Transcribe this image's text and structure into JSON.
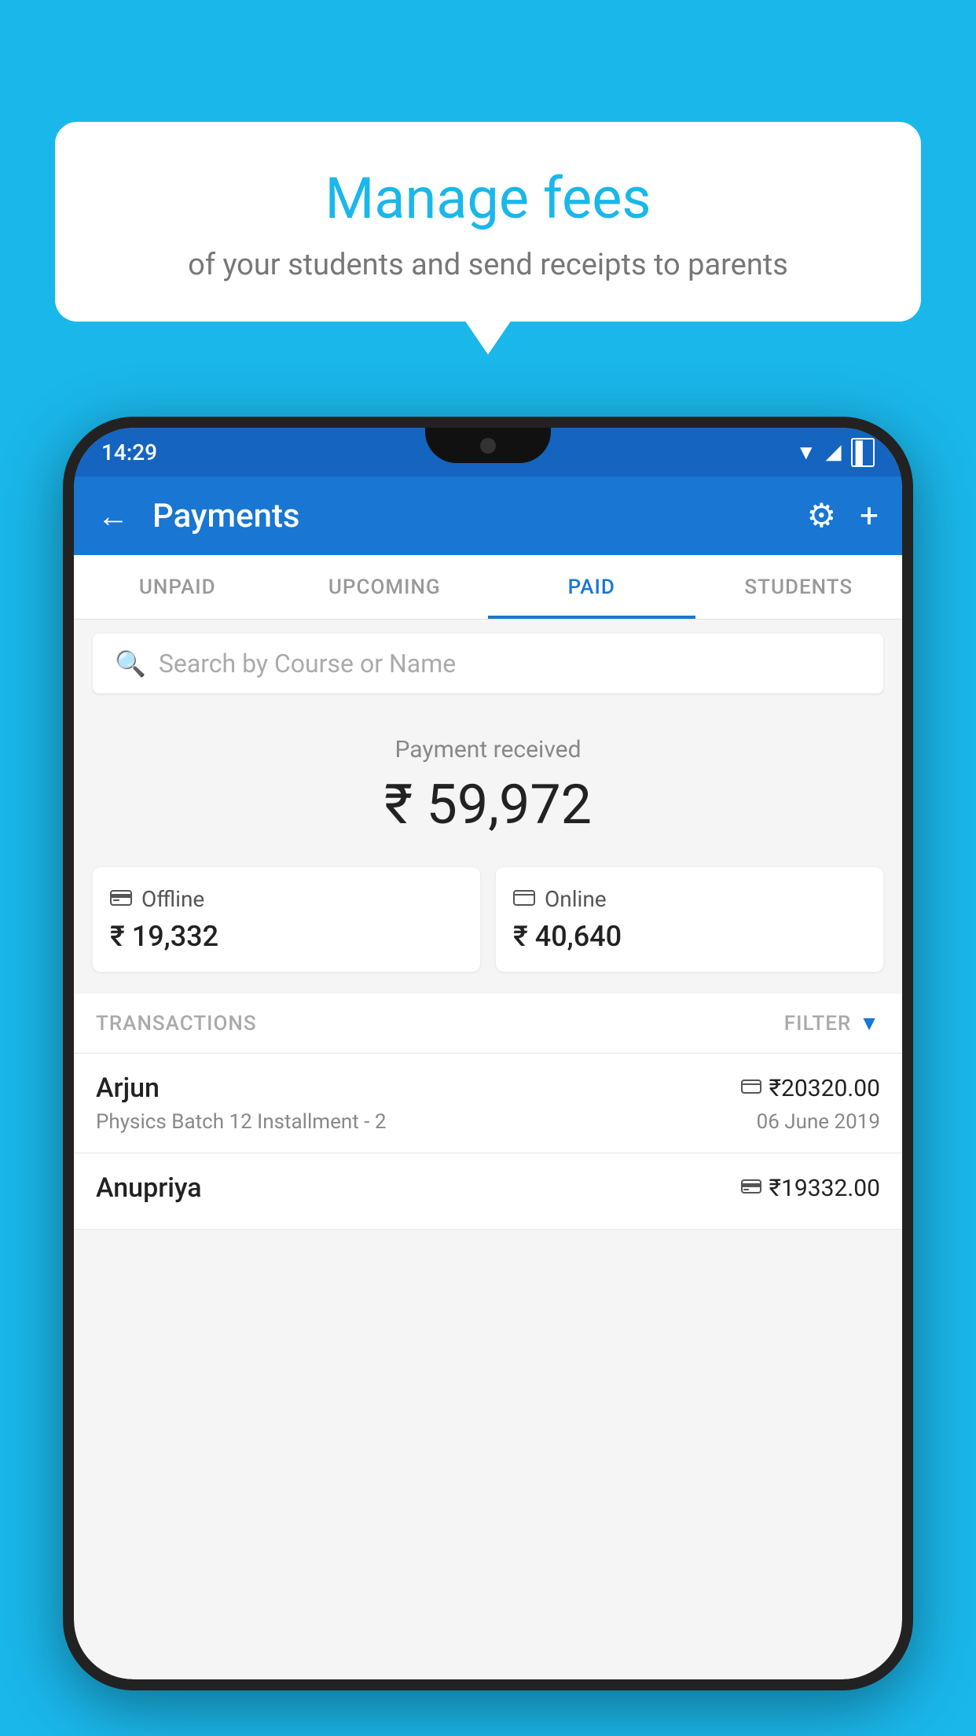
{
  "background_color": "#1AB7EA",
  "bubble": {
    "title": "Manage fees",
    "subtitle": "of your students and send receipts to parents"
  },
  "status_bar": {
    "time": "14:29"
  },
  "app_bar": {
    "title": "Payments",
    "back_label": "←",
    "gear_label": "⚙",
    "plus_label": "+"
  },
  "tabs": [
    {
      "label": "UNPAID",
      "active": false
    },
    {
      "label": "UPCOMING",
      "active": false
    },
    {
      "label": "PAID",
      "active": true
    },
    {
      "label": "STUDENTS",
      "active": false
    }
  ],
  "search": {
    "placeholder": "Search by Course or Name"
  },
  "payment_received": {
    "label": "Payment received",
    "amount": "₹ 59,972"
  },
  "payment_cards": [
    {
      "type": "Offline",
      "amount": "₹ 19,332",
      "icon": "💳"
    },
    {
      "type": "Online",
      "amount": "₹ 40,640",
      "icon": "💳"
    }
  ],
  "transactions": {
    "header": "TRANSACTIONS",
    "filter": "FILTER"
  },
  "transaction_rows": [
    {
      "name": "Arjun",
      "description": "Physics Batch 12 Installment - 2",
      "amount": "₹20320.00",
      "date": "06 June 2019",
      "payment_type": "online"
    },
    {
      "name": "Anupriya",
      "description": "",
      "amount": "₹19332.00",
      "date": "",
      "payment_type": "offline"
    }
  ]
}
